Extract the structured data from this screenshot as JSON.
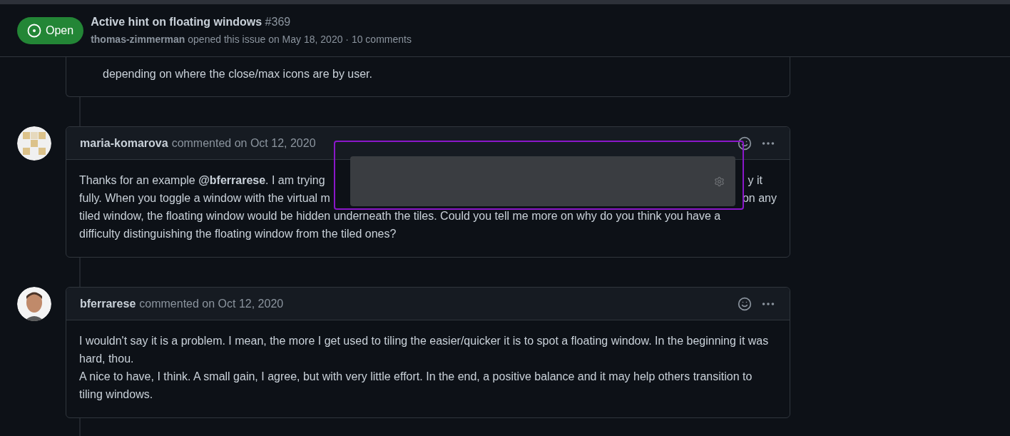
{
  "issue": {
    "status": {
      "label": "Open"
    },
    "title": "Active hint on floating windows",
    "number": "#369",
    "author": "thomas-zimmerman",
    "meta": "opened this issue on May 18, 2020 · 10 comments"
  },
  "comments": [
    {
      "kind": "partial",
      "paragraphs": [
        "depending on where the close/max icons are by user."
      ]
    },
    {
      "kind": "covered",
      "author": "maria-komarova",
      "action": "commented on Oct 12, 2020",
      "avatar": {
        "kind": "identicon"
      },
      "lines": [
        {
          "left": "Thanks for an example **@bferrarese**. I am trying",
          "right": "y it"
        },
        {
          "left": "fully. When you toggle a window with the virtual m",
          "right": "on any"
        },
        {
          "left": "tiled window, the floating window would be hidden underneath the tiles. Could you tell me more on why do you think you have a"
        },
        {
          "left": "difficulty distinguishing the floating window from the tiled ones?"
        }
      ]
    },
    {
      "kind": "full",
      "author": "bferrarese",
      "action": "commented on Oct 12, 2020",
      "avatar": {
        "kind": "photo"
      },
      "paragraphs": [
        "I wouldn't say it is a problem. I mean, the more I get used to tiling the easier/quicker it is to spot a floating window. In the beginning it was hard, thou.",
        "A nice to have, I think. A small gain, I agree, but with very little effort. In the end, a positive balance and it may help others transition to tiling windows."
      ]
    }
  ]
}
